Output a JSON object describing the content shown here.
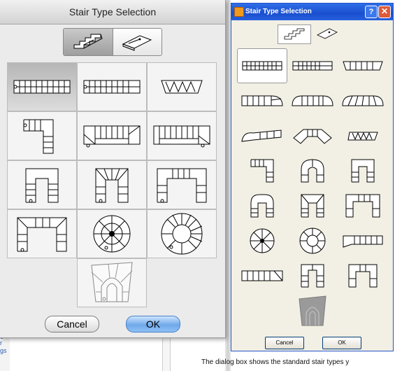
{
  "mac_dialog": {
    "title": "Stair Type Selection",
    "cancel_label": "Cancel",
    "ok_label": "OK",
    "view_mode": [
      "3d-stair-icon",
      "2d-plan-icon"
    ],
    "tiles": [
      "straight-stair-icon",
      "straight-stair-icon",
      "winder-stair-icon",
      "l-shaped-stair-icon",
      "straight-landing-stair-icon",
      "straight-landing-stair-icon",
      "u-shaped-stair-icon",
      "u-shaped-stair-icon",
      "u-shaped-stair-icon",
      "u-shaped-stair-icon",
      "spiral-stair-icon",
      "spiral-stair-icon"
    ],
    "last_tile": "custom-stair-icon"
  },
  "windows_dialog": {
    "title": "Stair Type Selection",
    "help_label": "?",
    "close_label": "✕",
    "cancel_label": "Cancel",
    "ok_label": "OK"
  },
  "background": {
    "links": [
      "g",
      "r",
      "gs"
    ],
    "caption": "The dialog box shows the standard stair types y"
  },
  "colors": {
    "mac_ok": "#6fa9ea",
    "win_title": "#1a4fcf",
    "win_face": "#f2efe4"
  }
}
